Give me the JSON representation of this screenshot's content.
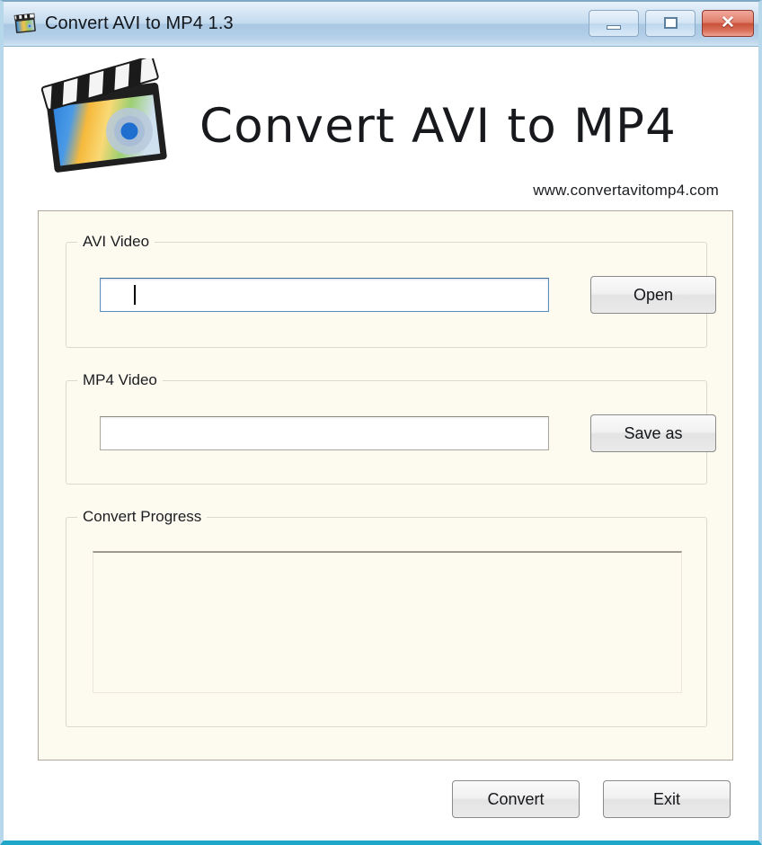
{
  "window": {
    "title": "Convert AVI to MP4 1.3",
    "icon": "clapperboard-icon",
    "controls": {
      "minimize_label": "–",
      "maximize_label": "□",
      "close_label": "✕"
    }
  },
  "header": {
    "app_title": "Convert AVI to MP4",
    "site_url": "www.convertavitomp4.com",
    "logo_icon": "clapperboard-logo"
  },
  "groups": {
    "avi": {
      "label": "AVI Video",
      "input_value": "",
      "input_placeholder": "",
      "button_label": "Open",
      "focused": true
    },
    "mp4": {
      "label": "MP4 Video",
      "input_value": "",
      "input_placeholder": "",
      "button_label": "Save as",
      "focused": false
    },
    "progress": {
      "label": "Convert Progress",
      "log_text": ""
    }
  },
  "footer": {
    "convert_label": "Convert",
    "exit_label": "Exit"
  },
  "colors": {
    "panel_background": "#fdfaef",
    "panel_border": "#b0a99a",
    "titlebar_blue": "#c3daee",
    "close_red": "#c9513a",
    "window_frame": "#b7d7ea",
    "focus_border": "#5d8fc0"
  }
}
